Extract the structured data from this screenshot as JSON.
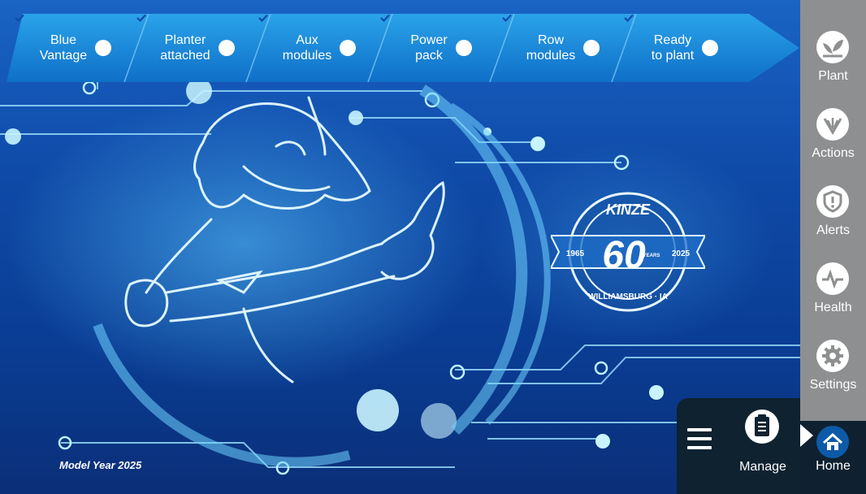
{
  "status_steps": [
    {
      "label": "Blue\nVantage",
      "done": true
    },
    {
      "label": "Planter\nattached",
      "done": true
    },
    {
      "label": "Aux\nmodules",
      "done": true
    },
    {
      "label": "Power\npack",
      "done": true
    },
    {
      "label": "Row\nmodules",
      "done": true
    },
    {
      "label": "Ready\nto plant",
      "done": true
    }
  ],
  "logo": {
    "brand": "KINZE",
    "start_year": "1965",
    "number": "60",
    "unit": "YEARS",
    "end_year": "2025",
    "place": "WILLIAMSBURG · IA"
  },
  "model_year": "Model Year 2025",
  "manage": {
    "label": "Manage"
  },
  "nav": [
    {
      "label": "Plant",
      "icon": "plant-icon"
    },
    {
      "label": "Actions",
      "icon": "actions-icon"
    },
    {
      "label": "Alerts",
      "icon": "alert-shield-icon"
    },
    {
      "label": "Health",
      "icon": "health-pulse-icon"
    },
    {
      "label": "Settings",
      "icon": "gear-icon"
    },
    {
      "label": "Home",
      "icon": "home-icon",
      "active": true
    }
  ],
  "colors": {
    "ribbon": "#1782d6",
    "sidebar": "#8d8f90",
    "active_nav": "#0f2130",
    "accent": "#0d5aa8"
  }
}
